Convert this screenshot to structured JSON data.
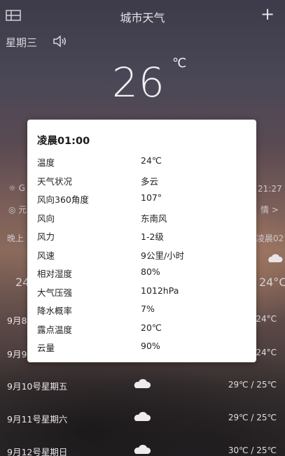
{
  "header": {
    "title": "城市天气",
    "add_label": "+"
  },
  "current": {
    "weekday": "星期三",
    "temperature": "26",
    "unit": "℃"
  },
  "background_fragments": {
    "left_sun_char": "☼ G",
    "right_time": "21:27",
    "left_row2": "◎ 元",
    "right_row2": "情 >",
    "evening_label": "晚上",
    "morning_label": "凌晨02",
    "left_temp": "24",
    "right_temp": "24°C"
  },
  "forecast": [
    {
      "day": "9月8",
      "range": "24°C"
    },
    {
      "day": "9月9",
      "range": "24°C"
    },
    {
      "day": "9月10号星期五",
      "range": "29℃ / 25℃"
    },
    {
      "day": "9月11号星期六",
      "range": "29℃ / 25℃"
    },
    {
      "day": "9月12号星期日",
      "range": "30℃ / 25℃"
    }
  ],
  "dialog": {
    "title": "凌晨01:00",
    "rows": [
      {
        "key": "温度",
        "value": "24℃"
      },
      {
        "key": "天气状况",
        "value": "多云"
      },
      {
        "key": "风向360角度",
        "value": "107°"
      },
      {
        "key": "风向",
        "value": "东南风"
      },
      {
        "key": "风力",
        "value": "1-2级"
      },
      {
        "key": "风速",
        "value": "9公里/小时"
      },
      {
        "key": "相对湿度",
        "value": "80%"
      },
      {
        "key": "大气压强",
        "value": "1012hPa"
      },
      {
        "key": "降水概率",
        "value": "7%"
      },
      {
        "key": "露点温度",
        "value": "20℃"
      },
      {
        "key": "云量",
        "value": "90%"
      }
    ]
  }
}
